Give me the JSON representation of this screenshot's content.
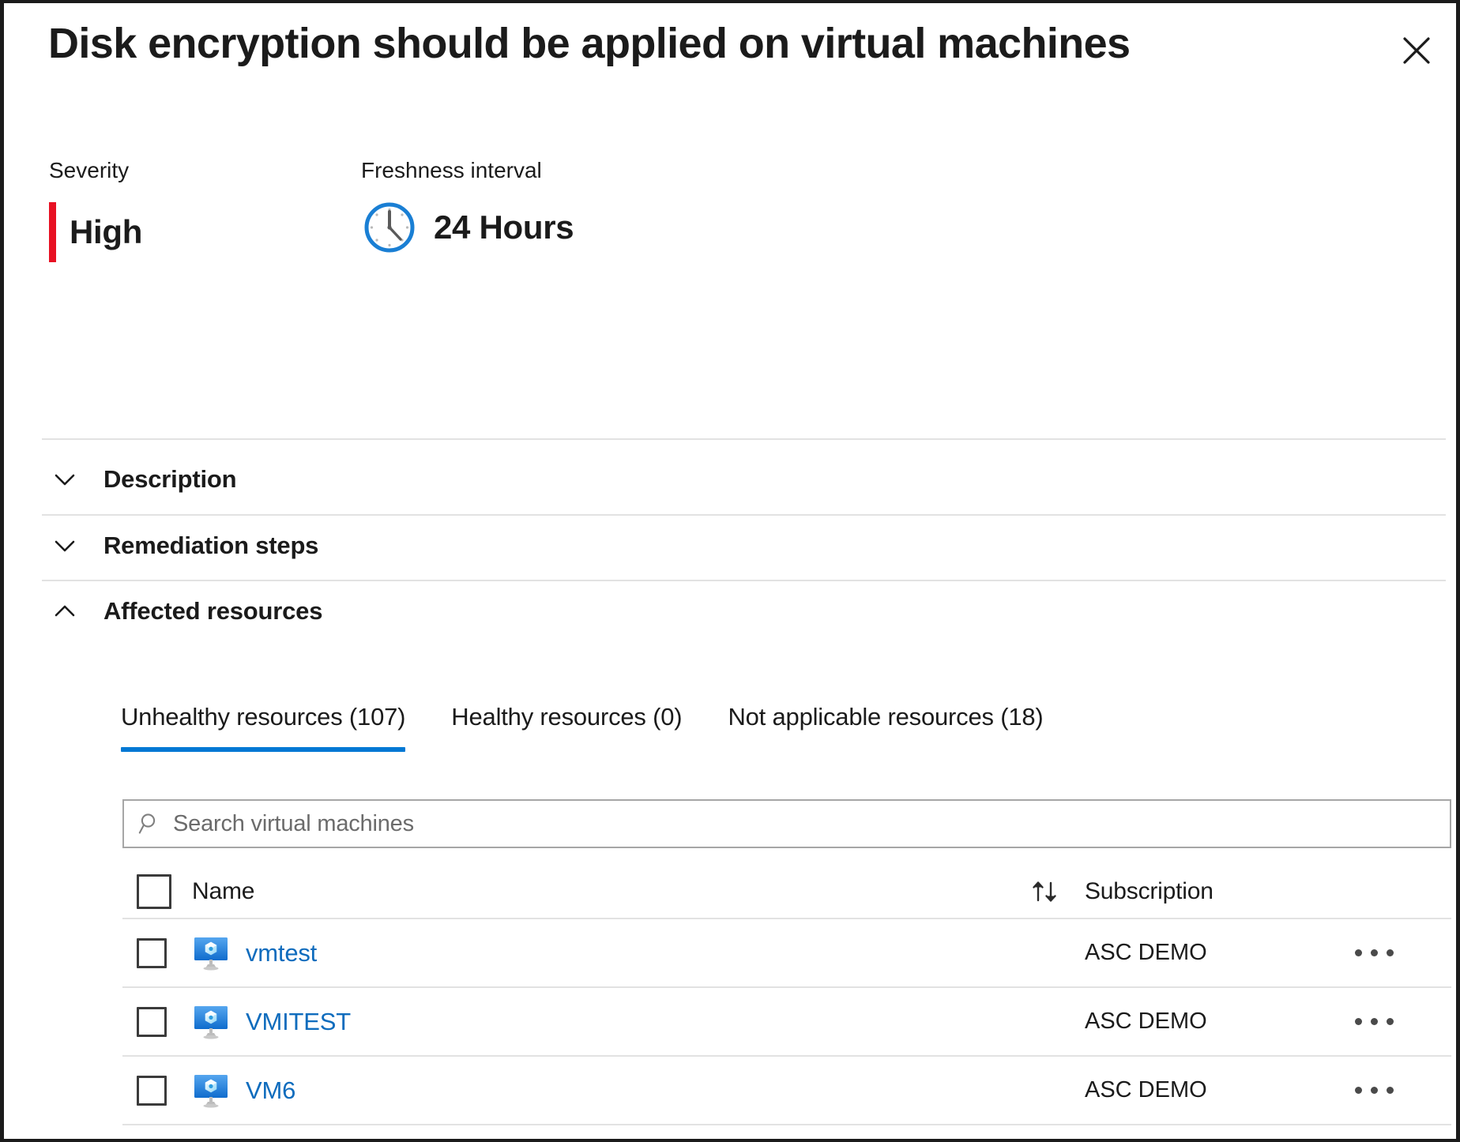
{
  "header": {
    "title": "Disk encryption should be applied on virtual machines",
    "close_icon": "close-icon"
  },
  "meta": {
    "severity": {
      "label": "Severity",
      "value": "High",
      "color": "#e81123"
    },
    "freshness": {
      "label": "Freshness interval",
      "value": "24 Hours",
      "icon": "clock-icon"
    }
  },
  "accordions": [
    {
      "label": "Description",
      "expanded": false,
      "icon": "chevron-down-icon"
    },
    {
      "label": "Remediation steps",
      "expanded": false,
      "icon": "chevron-down-icon"
    },
    {
      "label": "Affected resources",
      "expanded": true,
      "icon": "chevron-up-icon"
    }
  ],
  "tabs": [
    {
      "label": "Unhealthy resources (107)",
      "active": true
    },
    {
      "label": "Healthy resources (0)",
      "active": false
    },
    {
      "label": "Not applicable resources (18)",
      "active": false
    }
  ],
  "search": {
    "placeholder": "Search virtual machines",
    "value": "",
    "icon": "search-icon"
  },
  "table": {
    "columns": {
      "name": "Name",
      "subscription": "Subscription",
      "sort_icon": "sort-ascending-descending-icon"
    },
    "rows": [
      {
        "name": "vmtest",
        "subscription": "ASC DEMO",
        "icon": "virtual-machine-icon"
      },
      {
        "name": "VMITEST",
        "subscription": "ASC DEMO",
        "icon": "virtual-machine-icon"
      },
      {
        "name": "VM6",
        "subscription": "ASC DEMO",
        "icon": "virtual-machine-icon"
      }
    ]
  },
  "theme": {
    "accent": "#0078d4",
    "link": "#0f6cbd",
    "severity_high": "#e81123",
    "divider": "#e2e2e2",
    "text": "#1b1b1b"
  }
}
